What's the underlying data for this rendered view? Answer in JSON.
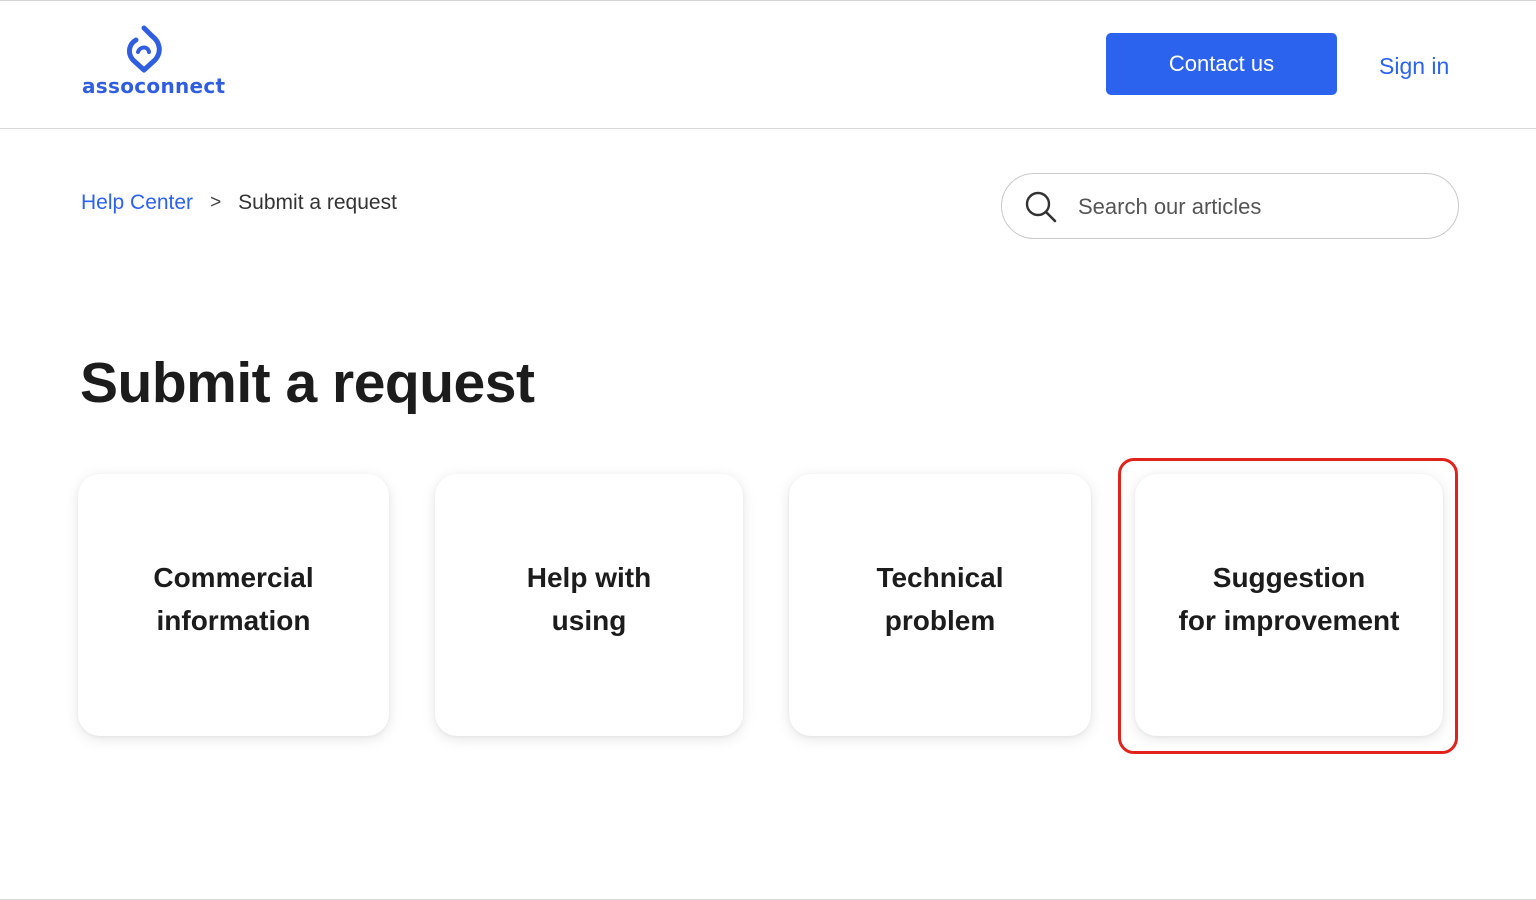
{
  "header": {
    "logo_text": "assoconnect",
    "contact_label": "Contact us",
    "signin_label": "Sign in"
  },
  "breadcrumb": {
    "home": "Help Center",
    "separator": ">",
    "current": "Submit a request"
  },
  "search": {
    "placeholder": "Search our articles"
  },
  "main": {
    "title": "Submit a request",
    "cards": [
      {
        "label": "Commercial\ninformation"
      },
      {
        "label": "Help with\nusing"
      },
      {
        "label": "Technical\nproblem"
      },
      {
        "label": "Suggestion\nfor improvement"
      }
    ]
  },
  "colors": {
    "brand": "#2b63ee",
    "highlight": "#e0241b"
  }
}
